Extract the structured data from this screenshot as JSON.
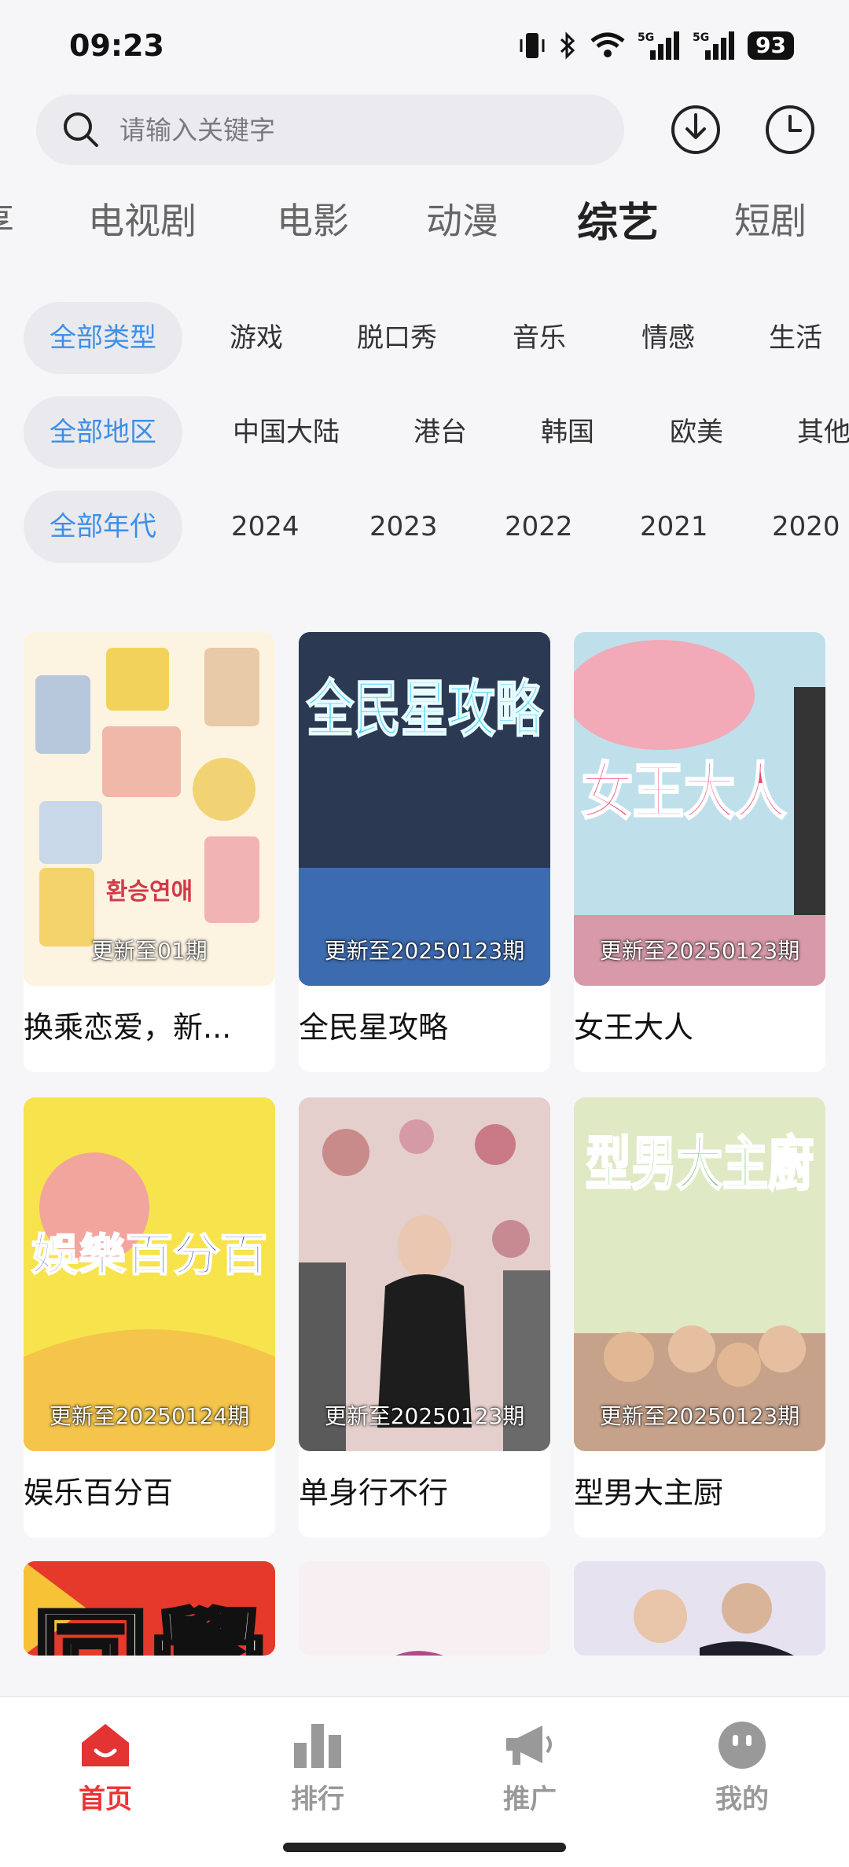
{
  "status_bar": {
    "time": "09:23",
    "battery": "93",
    "signal_labels": [
      "5G",
      "5G"
    ]
  },
  "search": {
    "placeholder": "请输入关键字"
  },
  "tabs": [
    "享",
    "电视剧",
    "电影",
    "动漫",
    "综艺",
    "短剧"
  ],
  "active_tab": "综艺",
  "filters": {
    "type": [
      "全部类型",
      "游戏",
      "脱口秀",
      "音乐",
      "情感",
      "生活"
    ],
    "region": [
      "全部地区",
      "中国大陆",
      "港台",
      "韩国",
      "欧美",
      "其他"
    ],
    "year": [
      "全部年代",
      "2024",
      "2023",
      "2022",
      "2021",
      "2020"
    ]
  },
  "cards": [
    {
      "title": "换乘恋爱，新...",
      "update": "更新至01期",
      "poster_text": "환승연애"
    },
    {
      "title": "全民星攻略",
      "update": "更新至20250123期",
      "poster_text": "全民星攻略"
    },
    {
      "title": "女王大人",
      "update": "更新至20250123期",
      "poster_text": "女王大人"
    },
    {
      "title": "娱乐百分百",
      "update": "更新至20250124期",
      "poster_text": "娛樂百分百"
    },
    {
      "title": "单身行不行",
      "update": "更新至20250123期",
      "poster_text": ""
    },
    {
      "title": "型男大主厨",
      "update": "更新至20250123期",
      "poster_text": "型男大主廚"
    },
    {
      "title": "",
      "update": "",
      "poster_text": "同學"
    },
    {
      "title": "",
      "update": "",
      "poster_text": ""
    },
    {
      "title": "",
      "update": "",
      "poster_text": ""
    }
  ],
  "bottom_nav": [
    "首页",
    "排行",
    "推广",
    "我的"
  ],
  "colors": {
    "accent_blue": "#3c8fe8",
    "accent_red": "#e33333",
    "background": "#f6f6f8"
  }
}
